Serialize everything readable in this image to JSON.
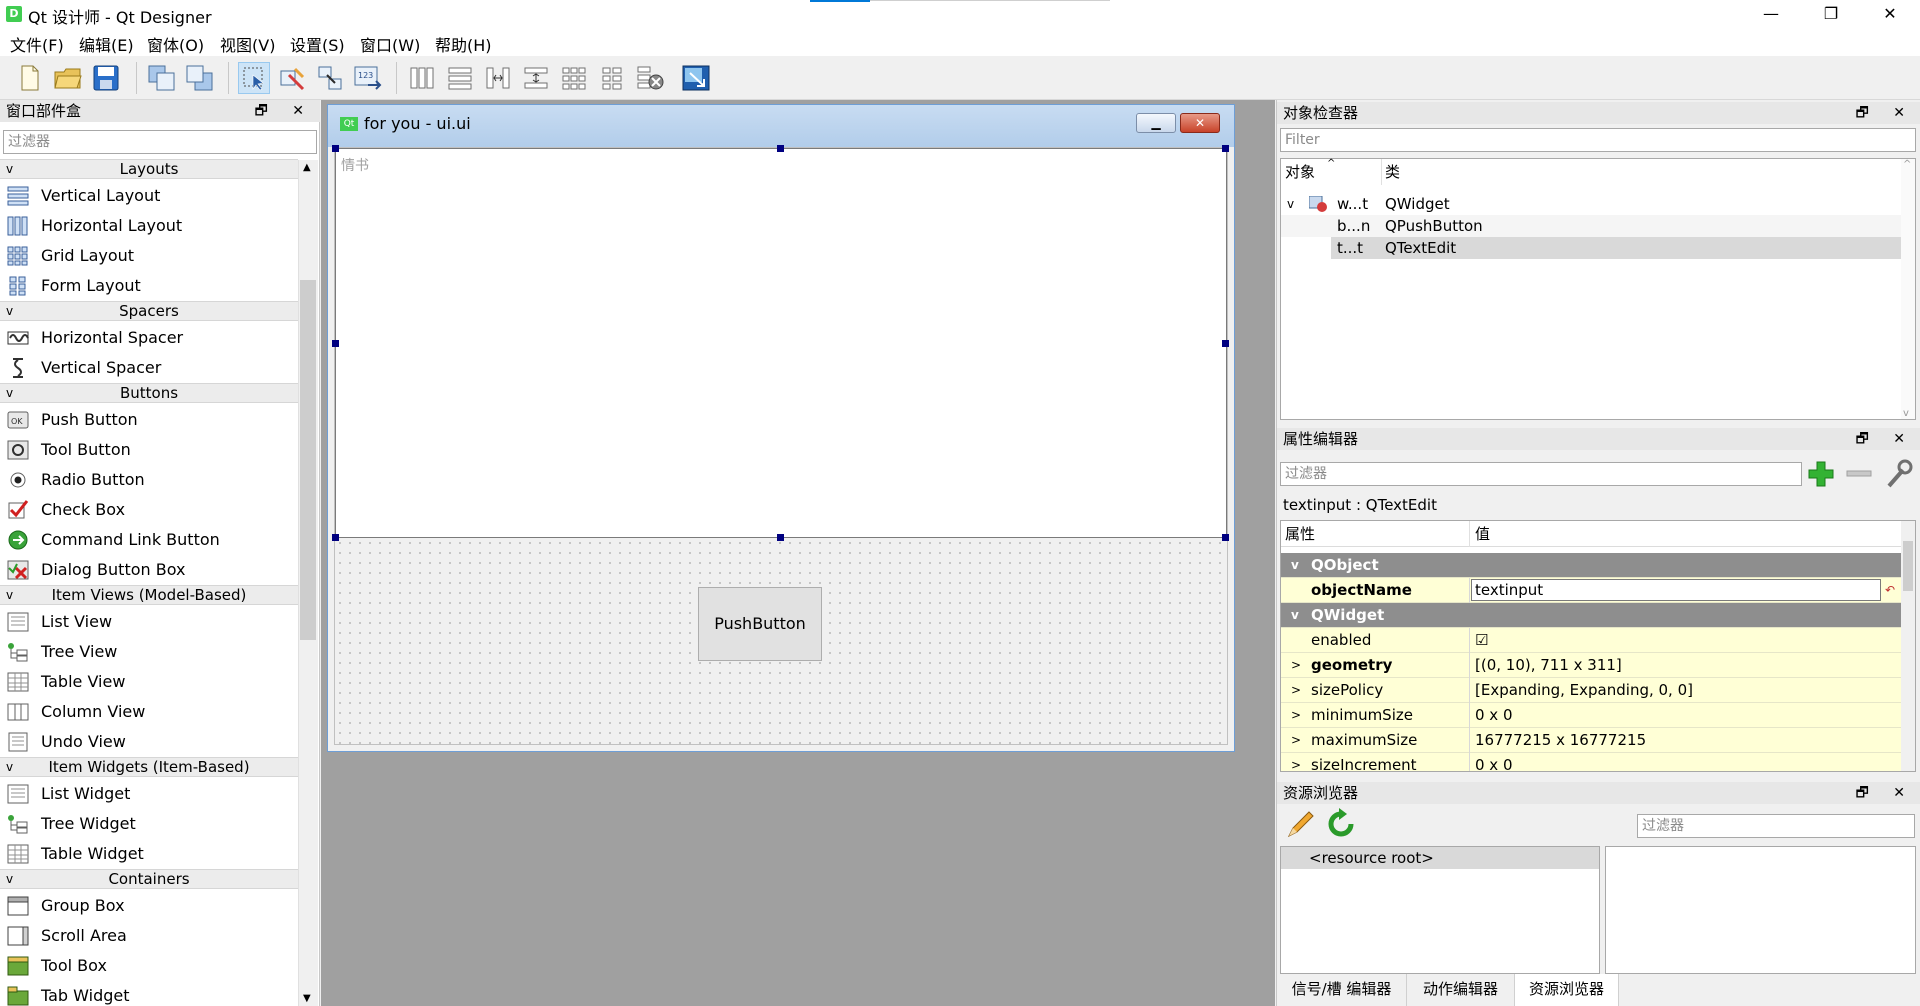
{
  "window": {
    "title": "Qt 设计师 - Qt Designer",
    "app_icon": "D",
    "controls": [
      "—",
      "❐",
      "✕"
    ]
  },
  "menus": [
    "文件(F)",
    "编辑(E)",
    "窗体(O)",
    "视图(V)",
    "设置(S)",
    "窗口(W)",
    "帮助(H)"
  ],
  "toolbar": {
    "icons": [
      "new-file-icon",
      "open-folder-icon",
      "save-disk-icon",
      "bring-front-icon",
      "send-back-icon",
      "edit-widgets-icon",
      "edit-signals-icon",
      "edit-buddies-icon",
      "edit-tab-order-icon",
      "layout-horizontal-icon",
      "layout-vertical-icon",
      "layout-h-splitter-icon",
      "layout-v-splitter-icon",
      "layout-grid-icon",
      "layout-form-icon",
      "break-layout-icon",
      "adjust-size-icon"
    ]
  },
  "widget_box": {
    "title": "窗口部件盒",
    "filter_placeholder": "过滤器",
    "categories": [
      {
        "name": "Layouts",
        "items": [
          "Vertical Layout",
          "Horizontal Layout",
          "Grid Layout",
          "Form Layout"
        ]
      },
      {
        "name": "Spacers",
        "items": [
          "Horizontal Spacer",
          "Vertical Spacer"
        ]
      },
      {
        "name": "Buttons",
        "items": [
          "Push Button",
          "Tool Button",
          "Radio Button",
          "Check Box",
          "Command Link Button",
          "Dialog Button Box"
        ]
      },
      {
        "name": "Item Views (Model-Based)",
        "items": [
          "List View",
          "Tree View",
          "Table View",
          "Column View",
          "Undo View"
        ]
      },
      {
        "name": "Item Widgets (Item-Based)",
        "items": [
          "List Widget",
          "Tree Widget",
          "Table Widget"
        ]
      },
      {
        "name": "Containers",
        "items": [
          "Group Box",
          "Scroll Area",
          "Tool Box",
          "Tab Widget"
        ]
      }
    ]
  },
  "form": {
    "title": "for you - ui.ui",
    "icon_text": "Qt",
    "textedit_placeholder": "情书",
    "pushbutton_label": "PushButton"
  },
  "object_inspector": {
    "title": "对象检查器",
    "filter_placeholder": "Filter",
    "col_object": "对象",
    "col_class": "类",
    "rows": [
      {
        "object": "w...t",
        "class": "QWidget"
      },
      {
        "object": "b...n",
        "class": "QPushButton"
      },
      {
        "object": "t...t",
        "class": "QTextEdit"
      }
    ]
  },
  "property_editor": {
    "title": "属性编辑器",
    "filter_placeholder": "过滤器",
    "current": "textinput : QTextEdit",
    "col_property": "属性",
    "col_value": "值",
    "section_qobject": "QObject",
    "section_qwidget": "QWidget",
    "rows": [
      {
        "name": "objectName",
        "value": "textinput"
      },
      {
        "name": "enabled",
        "value": "☑"
      },
      {
        "name": "geometry",
        "value": "[(0, 10), 711 x 311]"
      },
      {
        "name": "sizePolicy",
        "value": "[Expanding, Expanding, 0, 0]"
      },
      {
        "name": "minimumSize",
        "value": "0 x 0"
      },
      {
        "name": "maximumSize",
        "value": "16777215 x 16777215"
      },
      {
        "name": "sizeIncrement",
        "value": "0 x 0"
      }
    ]
  },
  "resource_browser": {
    "title": "资源浏览器",
    "filter_placeholder": "过滤器",
    "root": "<resource root>"
  },
  "bottom_tabs": [
    "信号/槽 编辑器",
    "动作编辑器",
    "资源浏览器"
  ],
  "dock_buttons": "🗗 ✕"
}
